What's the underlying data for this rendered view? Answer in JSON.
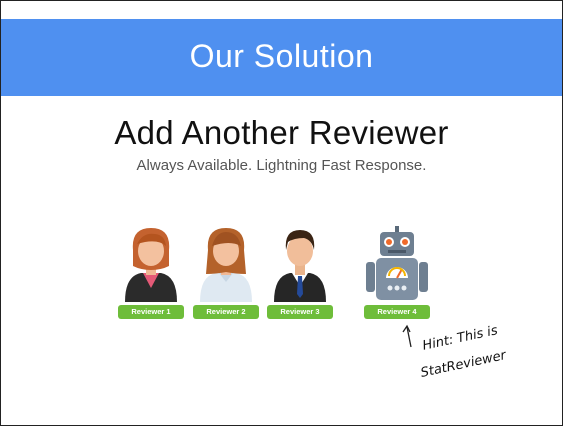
{
  "slide": {
    "banner_title": "Our Solution",
    "heading": "Add Another Reviewer",
    "subheading": "Always Available.  Lightning Fast Response."
  },
  "reviewers": [
    {
      "label": "Reviewer 1",
      "icon": "female-reviewer-icon"
    },
    {
      "label": "Reviewer 2",
      "icon": "female-reviewer-icon"
    },
    {
      "label": "Reviewer 3",
      "icon": "male-reviewer-icon"
    },
    {
      "label": "Reviewer 4",
      "icon": "robot-icon"
    }
  ],
  "hint": {
    "line1": "Hint: This is",
    "line2": "StatReviewer"
  },
  "colors": {
    "banner": "#4f90f0",
    "badge": "#6ebd3a"
  }
}
